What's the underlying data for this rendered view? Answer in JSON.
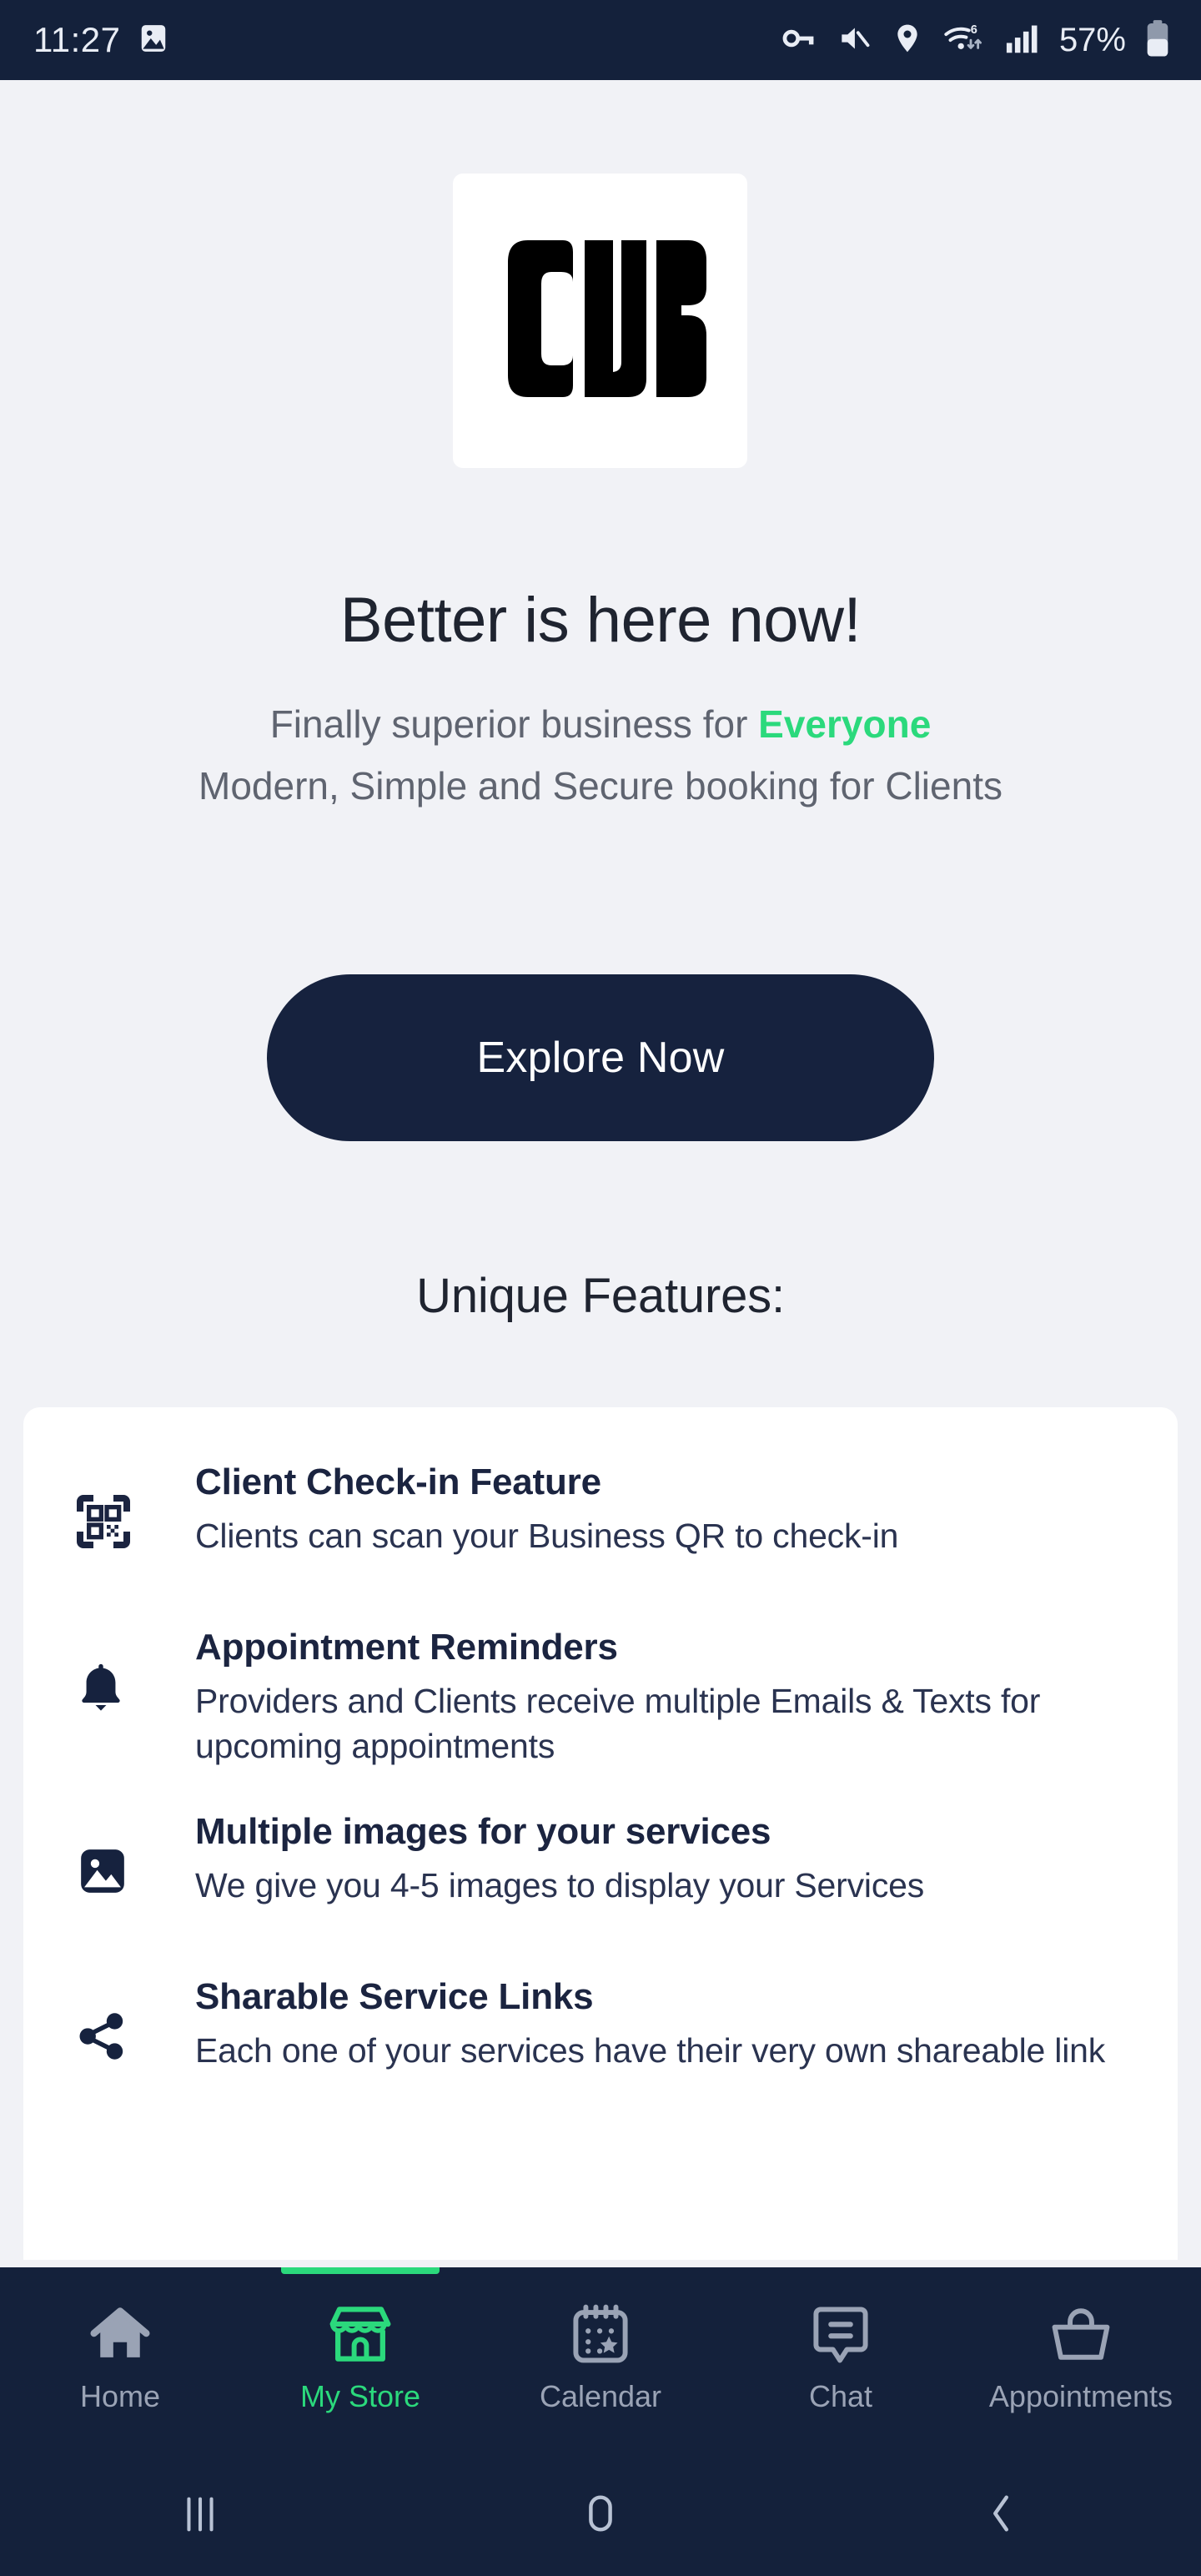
{
  "statusbar": {
    "time": "11:27",
    "battery_percent": "57%",
    "icons": {
      "gallery": "image-icon",
      "vpn_key": "key-icon",
      "mute": "speaker-mute-icon",
      "location": "location-pin-icon",
      "wifi": "wifi-6-icon",
      "wifi_badge": "6",
      "signal": "cellular-signal-icon",
      "battery": "battery-icon"
    },
    "colors": {
      "background": "#14213B",
      "foreground": "#E9EDF5"
    }
  },
  "logo": {
    "name": "cub-logo",
    "text": "CUB",
    "card_background": "#FFFFFF",
    "glyph_color": "#000000"
  },
  "hero": {
    "title": "Better is here now!",
    "subtitle_line1_prefix": "Finally superior business for ",
    "subtitle_line1_accent": "Everyone",
    "subtitle_line2": "Modern, Simple and Secure booking for Clients",
    "accent_color": "#2BD97C",
    "title_color": "#1F2430",
    "subtitle_color": "#5F6470"
  },
  "cta": {
    "label": "Explore Now",
    "background": "#16223E",
    "text_color": "#FFFFFF"
  },
  "features": {
    "heading": "Unique Features:",
    "items": [
      {
        "icon": "qr-code-scan-icon",
        "title": "Client Check-in Feature",
        "description": "Clients can scan your Business QR to check-in"
      },
      {
        "icon": "bell-icon",
        "title": "Appointment Reminders",
        "description": "Providers and Clients receive multiple Emails & Texts for upcoming appointments"
      },
      {
        "icon": "image-icon",
        "title": "Multiple images for your services",
        "description": "We give you 4-5 images to display your Services"
      },
      {
        "icon": "share-icon",
        "title": "Sharable Service Links",
        "description": "Each one of your services have their very own shareable link"
      }
    ],
    "card_background": "#FFFFFF",
    "title_color": "#1B2440"
  },
  "bottom_nav": {
    "active_index": 1,
    "active_color": "#2BD97C",
    "inactive_color": "#9AA3B5",
    "background": "#14213B",
    "items": [
      {
        "label": "Home",
        "icon": "home-icon"
      },
      {
        "label": "My Store",
        "icon": "store-icon"
      },
      {
        "label": "Calendar",
        "icon": "calendar-star-icon"
      },
      {
        "label": "Chat",
        "icon": "chat-bubble-icon"
      },
      {
        "label": "Appointments",
        "icon": "basket-icon"
      }
    ]
  },
  "android_nav": {
    "background": "#14213B",
    "buttons": [
      {
        "name": "recents-button",
        "icon": "recents-bars-icon"
      },
      {
        "name": "home-button",
        "icon": "home-pill-icon"
      },
      {
        "name": "back-button",
        "icon": "back-chevron-icon"
      }
    ]
  }
}
